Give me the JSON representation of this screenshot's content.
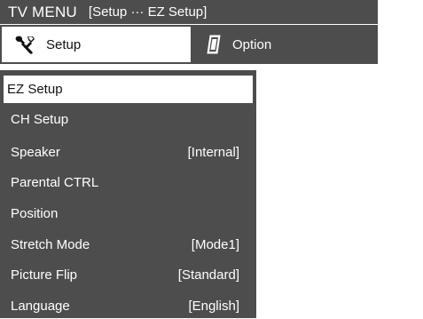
{
  "header": {
    "title": "TV MENU",
    "breadcrumb": "[Setup ··· EZ Setup]"
  },
  "tabs": [
    {
      "label": "Setup",
      "icon": "wrench-icon",
      "active": true
    },
    {
      "label": "Option",
      "icon": "document-icon",
      "active": false
    }
  ],
  "menu": {
    "items": [
      {
        "label": "EZ Setup",
        "value": "",
        "selected": true
      },
      {
        "label": "CH Setup",
        "value": ""
      },
      {
        "label": "Speaker",
        "value": "[Internal]"
      },
      {
        "label": "Parental CTRL",
        "value": ""
      },
      {
        "label": "Position",
        "value": ""
      },
      {
        "label": "Stretch Mode",
        "value": "[Mode1]"
      },
      {
        "label": "Picture Flip",
        "value": "[Standard]"
      },
      {
        "label": "Language",
        "value": "[English]"
      }
    ]
  },
  "colors": {
    "panel": "#4d4d4d",
    "highlight": "#ffffff",
    "text_light": "#ffffff",
    "text_dark": "#111111"
  }
}
